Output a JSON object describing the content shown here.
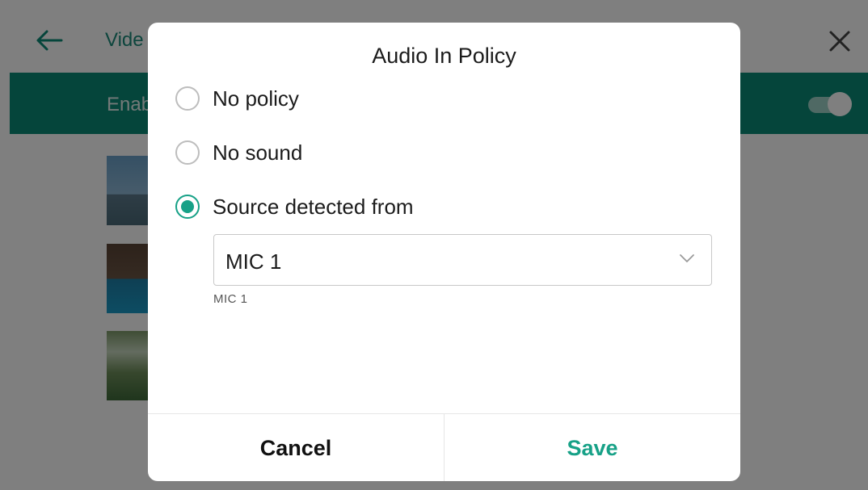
{
  "background": {
    "title": "Vide",
    "enable_label": "Enab",
    "toggle_on": true
  },
  "dialog": {
    "title": "Audio In Policy",
    "options": [
      {
        "label": "No policy",
        "selected": false
      },
      {
        "label": "No sound",
        "selected": false
      },
      {
        "label": "Source detected from",
        "selected": true
      }
    ],
    "source_select": {
      "value": "MIC 1",
      "helper": "MIC 1"
    },
    "cancel_label": "Cancel",
    "save_label": "Save"
  },
  "colors": {
    "accent": "#17a187",
    "header_bar": "#0b8a76"
  },
  "icons": {
    "back": "arrow-left-icon",
    "close": "close-icon",
    "dropdown": "chevron-down-icon"
  }
}
